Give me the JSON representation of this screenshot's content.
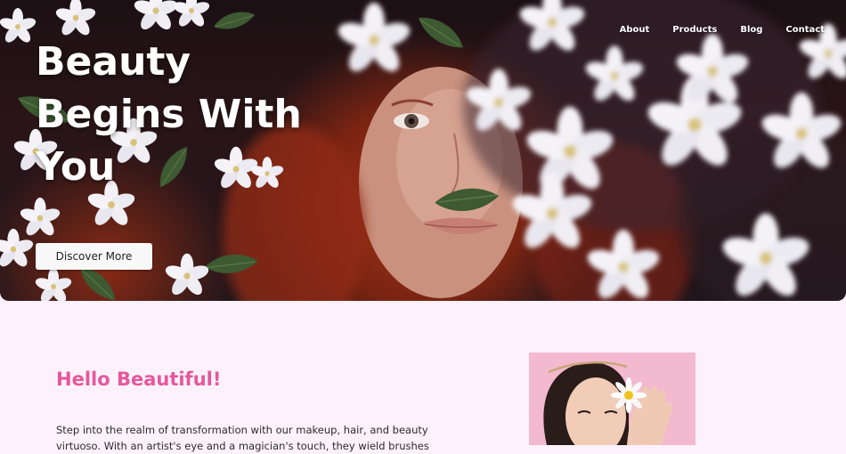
{
  "nav": {
    "items": [
      {
        "label": "About"
      },
      {
        "label": "Products"
      },
      {
        "label": "Blog"
      },
      {
        "label": "Contact"
      }
    ]
  },
  "hero": {
    "title": "Beauty Begins With You",
    "cta_label": "Discover More"
  },
  "intro": {
    "title": "Hello Beautiful!",
    "text": "Step into the realm of transformation with our makeup, hair, and beauty virtuoso. With an artist's eye and a magician's touch, they wield brushes"
  },
  "colors": {
    "accent": "#e6579d",
    "page_background": "#fdf2fb",
    "portrait_background": "#f3b9cf"
  }
}
